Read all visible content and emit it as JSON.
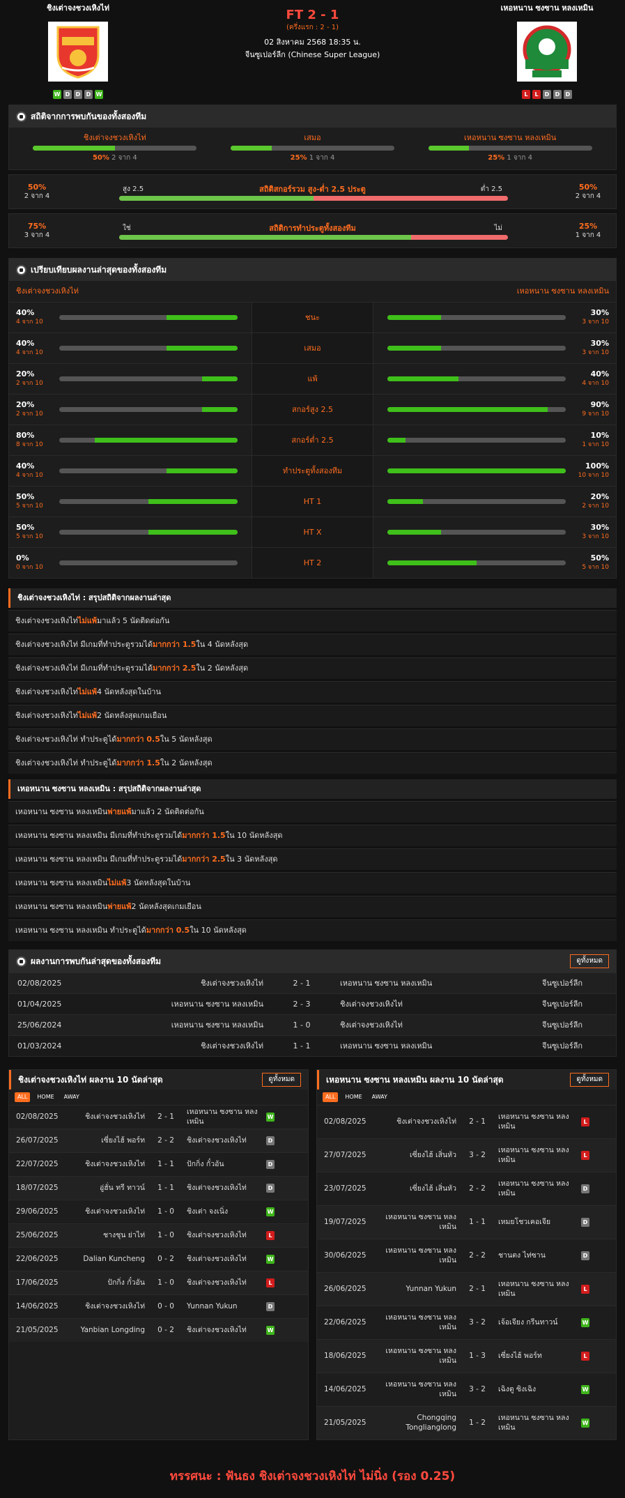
{
  "home": {
    "name": "ชิงเต่าจงชวงเหิงไท่",
    "form": [
      "W",
      "D",
      "D",
      "D",
      "W"
    ]
  },
  "away": {
    "name": "เหอหนาน ซงซาน หลงเหมิน",
    "form": [
      "L",
      "L",
      "D",
      "D",
      "D"
    ]
  },
  "match": {
    "score": "FT 2 - 1",
    "half": "(ครึ่งแรก : 2 - 1)",
    "date": "02 สิงหาคม 2568 18:35 น.",
    "league": "จีนซูเปอร์ลีก (Chinese Super League)"
  },
  "h2h_title": "สถิติจากการพบกันของทั้งสองทีม",
  "h2h": [
    {
      "label": "ชิงเต่าจงชวงเหิงไท่",
      "pct": "50%",
      "of": "2 จาก 4",
      "fill": 0.5
    },
    {
      "label": "เสมอ",
      "pct": "25%",
      "of": "1 จาก 4",
      "fill": 0.25
    },
    {
      "label": "เหอหนาน ซงซาน หลงเหมิน",
      "pct": "25%",
      "of": "1 จาก 4",
      "fill": 0.25
    }
  ],
  "ou": {
    "lpct": "50%",
    "lof": "2 จาก 4",
    "title": "สถิติสกอร์รวม สูง-ต่ำ 2.5 ประตู",
    "left": "สูง 2.5",
    "right": "ต่ำ 2.5",
    "rpct": "50%",
    "rof": "2 จาก 4",
    "fill": 0.5
  },
  "btts": {
    "lpct": "75%",
    "lof": "3 จาก 4",
    "title": "สถิติการทำประตูทั้งสองทีม",
    "left": "ใช่",
    "right": "ไม่",
    "rpct": "25%",
    "rof": "1 จาก 4",
    "fill": 0.75
  },
  "cmp_title": "เปรียบเทียบผลงานล่าสุดของทั้งสองทีม",
  "cmp": [
    {
      "label": "ชนะ",
      "lp": "40%",
      "lo": "4 จาก 10",
      "lf": 0.4,
      "rp": "30%",
      "ro": "3 จาก 10",
      "rf": 0.3
    },
    {
      "label": "เสมอ",
      "lp": "40%",
      "lo": "4 จาก 10",
      "lf": 0.4,
      "rp": "30%",
      "ro": "3 จาก 10",
      "rf": 0.3
    },
    {
      "label": "แพ้",
      "lp": "20%",
      "lo": "2 จาก 10",
      "lf": 0.2,
      "rp": "40%",
      "ro": "4 จาก 10",
      "rf": 0.4
    },
    {
      "label": "สกอร์สูง 2.5",
      "lp": "20%",
      "lo": "2 จาก 10",
      "lf": 0.2,
      "rp": "90%",
      "ro": "9 จาก 10",
      "rf": 0.9
    },
    {
      "label": "สกอร์ต่ำ 2.5",
      "lp": "80%",
      "lo": "8 จาก 10",
      "lf": 0.8,
      "rp": "10%",
      "ro": "1 จาก 10",
      "rf": 0.1
    },
    {
      "label": "ทำประตูทั้งสองทีม",
      "lp": "40%",
      "lo": "4 จาก 10",
      "lf": 0.4,
      "rp": "100%",
      "ro": "10 จาก 10",
      "rf": 1
    },
    {
      "label": "HT 1",
      "lp": "50%",
      "lo": "5 จาก 10",
      "lf": 0.5,
      "rp": "20%",
      "ro": "2 จาก 10",
      "rf": 0.2
    },
    {
      "label": "HT X",
      "lp": "50%",
      "lo": "5 จาก 10",
      "lf": 0.5,
      "rp": "30%",
      "ro": "3 จาก 10",
      "rf": 0.3
    },
    {
      "label": "HT 2",
      "lp": "0%",
      "lo": "0 จาก 10",
      "lf": 0,
      "rp": "50%",
      "ro": "5 จาก 10",
      "rf": 0.5
    }
  ],
  "hsum_title": "ชิงเต่าจงชวงเหิงไท่ : สรุปสถิติจากผลงานล่าสุด",
  "hsum": [
    [
      "ชิงเต่าจงชวงเหิงไท่ ",
      "ไม่แพ้",
      " มาแล้ว 5 นัดติดต่อกัน"
    ],
    [
      "ชิงเต่าจงชวงเหิงไท่ มีเกมที่ทำประตูรวมได้ ",
      "มากกว่า 1.5",
      " ใน 4 นัดหลังสุด"
    ],
    [
      "ชิงเต่าจงชวงเหิงไท่ มีเกมที่ทำประตูรวมได้ ",
      "มากกว่า 2.5",
      " ใน 2 นัดหลังสุด"
    ],
    [
      "ชิงเต่าจงชวงเหิงไท่ ",
      "ไม่แพ้",
      " 4 นัดหลังสุดในบ้าน"
    ],
    [
      "ชิงเต่าจงชวงเหิงไท่ ",
      "ไม่แพ้",
      " 2 นัดหลังสุดเกมเยือน"
    ],
    [
      "ชิงเต่าจงชวงเหิงไท่ ทำประตูได้ ",
      "มากกว่า 0.5",
      " ใน 5 นัดหลังสุด"
    ],
    [
      "ชิงเต่าจงชวงเหิงไท่ ทำประตูได้ ",
      "มากกว่า 1.5",
      " ใน 2 นัดหลังสุด"
    ]
  ],
  "asum_title": "เหอหนาน ซงซาน หลงเหมิน : สรุปสถิติจากผลงานล่าสุด",
  "asum": [
    [
      "เหอหนาน ซงซาน หลงเหมิน ",
      "พ่ายแพ้",
      " มาแล้ว 2 นัดติดต่อกัน"
    ],
    [
      "เหอหนาน ซงซาน หลงเหมิน มีเกมที่ทำประตูรวมได้ ",
      "มากกว่า 1.5",
      " ใน 10 นัดหลังสุด"
    ],
    [
      "เหอหนาน ซงซาน หลงเหมิน มีเกมที่ทำประตูรวมได้ ",
      "มากกว่า 2.5",
      " ใน 3 นัดหลังสุด"
    ],
    [
      "เหอหนาน ซงซาน หลงเหมิน ",
      "ไม่แพ้",
      " 3 นัดหลังสุดในบ้าน"
    ],
    [
      "เหอหนาน ซงซาน หลงเหมิน ",
      "พ่ายแพ้",
      " 2 นัดหลังสุดเกมเยือน"
    ],
    [
      "เหอหนาน ซงซาน หลงเหมิน ทำประตูได้ ",
      "มากกว่า 0.5",
      " ใน 10 นัดหลังสุด"
    ]
  ],
  "meet_title": "ผลงานการพบกันล่าสุดของทั้งสองทีม",
  "see_all": "ดูทั้งหมด",
  "meet": [
    [
      "02/08/2025",
      "ชิงเต่าจงชวงเหิงไท่",
      "2 - 1",
      "เหอหนาน ซงซาน หลงเหมิน",
      "จีนซูเปอร์ลีก"
    ],
    [
      "01/04/2025",
      "เหอหนาน ซงซาน หลงเหมิน",
      "2 - 3",
      "ชิงเต่าจงชวงเหิงไท่",
      "จีนซูเปอร์ลีก"
    ],
    [
      "25/06/2024",
      "เหอหนาน ซงซาน หลงเหมิน",
      "1 - 0",
      "ชิงเต่าจงชวงเหิงไท่",
      "จีนซูเปอร์ลีก"
    ],
    [
      "01/03/2024",
      "ชิงเต่าจงชวงเหิงไท่",
      "1 - 1",
      "เหอหนาน ซงซาน หลงเหมิน",
      "จีนซูเปอร์ลีก"
    ]
  ],
  "tabs": [
    "ALL",
    "HOME",
    "AWAY"
  ],
  "hlast_title": "ชิงเต่าจงชวงเหิงไท่ ผลงาน 10 นัดล่าสุด",
  "hlast": [
    [
      "02/08/2025",
      "ชิงเต่าจงชวงเหิงไท่",
      "2 - 1",
      "เหอหนาน ซงซาน หลงเหมิน",
      "W"
    ],
    [
      "26/07/2025",
      "เซี่ยงไฮ้ พอร์ท",
      "2 - 2",
      "ชิงเต่าจงชวงเหิงไท่",
      "D"
    ],
    [
      "22/07/2025",
      "ชิงเต่าจงชวงเหิงไท่",
      "1 - 1",
      "ปักกิ่ง กั๋วอัน",
      "D"
    ],
    [
      "18/07/2025",
      "อู่ฮั่น ทรี ทาวน์",
      "1 - 1",
      "ชิงเต่าจงชวงเหิงไท่",
      "D"
    ],
    [
      "29/06/2025",
      "ชิงเต่าจงชวงเหิงไท่",
      "1 - 0",
      "ชิงเต่า จงเนิ่ง",
      "W"
    ],
    [
      "25/06/2025",
      "ชางชุน ย่าไท่",
      "1 - 0",
      "ชิงเต่าจงชวงเหิงไท่",
      "L"
    ],
    [
      "22/06/2025",
      "Dalian Kuncheng",
      "0 - 2",
      "ชิงเต่าจงชวงเหิงไท่",
      "W"
    ],
    [
      "17/06/2025",
      "ปักกิ่ง กั๋วอัน",
      "1 - 0",
      "ชิงเต่าจงชวงเหิงไท่",
      "L"
    ],
    [
      "14/06/2025",
      "ชิงเต่าจงชวงเหิงไท่",
      "0 - 0",
      "Yunnan Yukun",
      "D"
    ],
    [
      "21/05/2025",
      "Yanbian Longding",
      "0 - 2",
      "ชิงเต่าจงชวงเหิงไท่",
      "W"
    ]
  ],
  "alast_title": "เหอหนาน ซงซาน หลงเหมิน ผลงาน 10 นัดล่าสุด",
  "alast": [
    [
      "02/08/2025",
      "ชิงเต่าจงชวงเหิงไท่",
      "2 - 1",
      "เหอหนาน ซงซาน หลงเหมิน",
      "L"
    ],
    [
      "27/07/2025",
      "เซี่ยงไฮ้ เสิ่นหัว",
      "3 - 2",
      "เหอหนาน ซงซาน หลงเหมิน",
      "L"
    ],
    [
      "23/07/2025",
      "เซี่ยงไฮ้ เสิ่นหัว",
      "2 - 2",
      "เหอหนาน ซงซาน หลงเหมิน",
      "D"
    ],
    [
      "19/07/2025",
      "เหอหนาน ซงซาน หลงเหมิน",
      "1 - 1",
      "เหมยโชวเคอเจีย",
      "D"
    ],
    [
      "30/06/2025",
      "เหอหนาน ซงซาน หลงเหมิน",
      "2 - 2",
      "ชานตง ไท่ซาน",
      "D"
    ],
    [
      "26/06/2025",
      "Yunnan Yukun",
      "2 - 1",
      "เหอหนาน ซงซาน หลงเหมิน",
      "L"
    ],
    [
      "22/06/2025",
      "เหอหนาน ซงซาน หลงเหมิน",
      "3 - 2",
      "เจ้อเจียง กรีนทาวน์",
      "W"
    ],
    [
      "18/06/2025",
      "เหอหนาน ซงซาน หลงเหมิน",
      "1 - 3",
      "เซี่ยงไฮ้ พอร์ท",
      "L"
    ],
    [
      "14/06/2025",
      "เหอหนาน ซงซาน หลงเหมิน",
      "3 - 2",
      "เฉิงตู ซิงเฉิง",
      "W"
    ],
    [
      "21/05/2025",
      "Chongqing Tonglianglong",
      "1 - 2",
      "เหอหนาน ซงซาน หลงเหมิน",
      "W"
    ]
  ],
  "prediction": {
    "label": "ทรรศนะ",
    "sep": " : ",
    "text": "ฟันธง ชิงเต่าจงชวงเหิงไท่ ไม่นิ่ง (รอง 0.25)"
  },
  "colors": {
    "accent": "#ff6d1f",
    "win": "#3fb51c",
    "lose": "#d31d1d",
    "draw": "#777777",
    "bar": "#5bc82d"
  },
  "icons": {
    "section": "soccer-ball-icon"
  }
}
